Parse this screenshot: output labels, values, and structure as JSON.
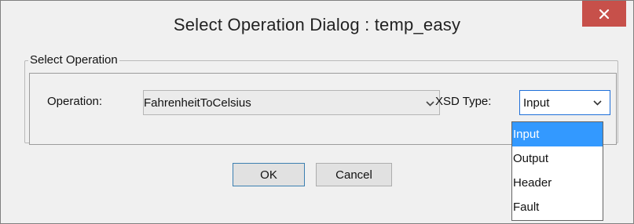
{
  "dialog": {
    "title": "Select Operation Dialog : temp_easy"
  },
  "group": {
    "legend": "Select Operation"
  },
  "operation": {
    "label": "Operation:",
    "selected": "FahrenheitToCelsius"
  },
  "xsd_type": {
    "label": "XSD Type:",
    "selected": "Input",
    "options": [
      "Input",
      "Output",
      "Header",
      "Fault"
    ],
    "highlighted_index": 0
  },
  "buttons": {
    "ok": "OK",
    "cancel": "Cancel"
  },
  "colors": {
    "close_button": "#c7504a",
    "highlight": "#3399ff",
    "focus_border": "#1e6fd9"
  },
  "icons": {
    "close": "close-icon",
    "dropdown": "chevron-down-icon"
  }
}
